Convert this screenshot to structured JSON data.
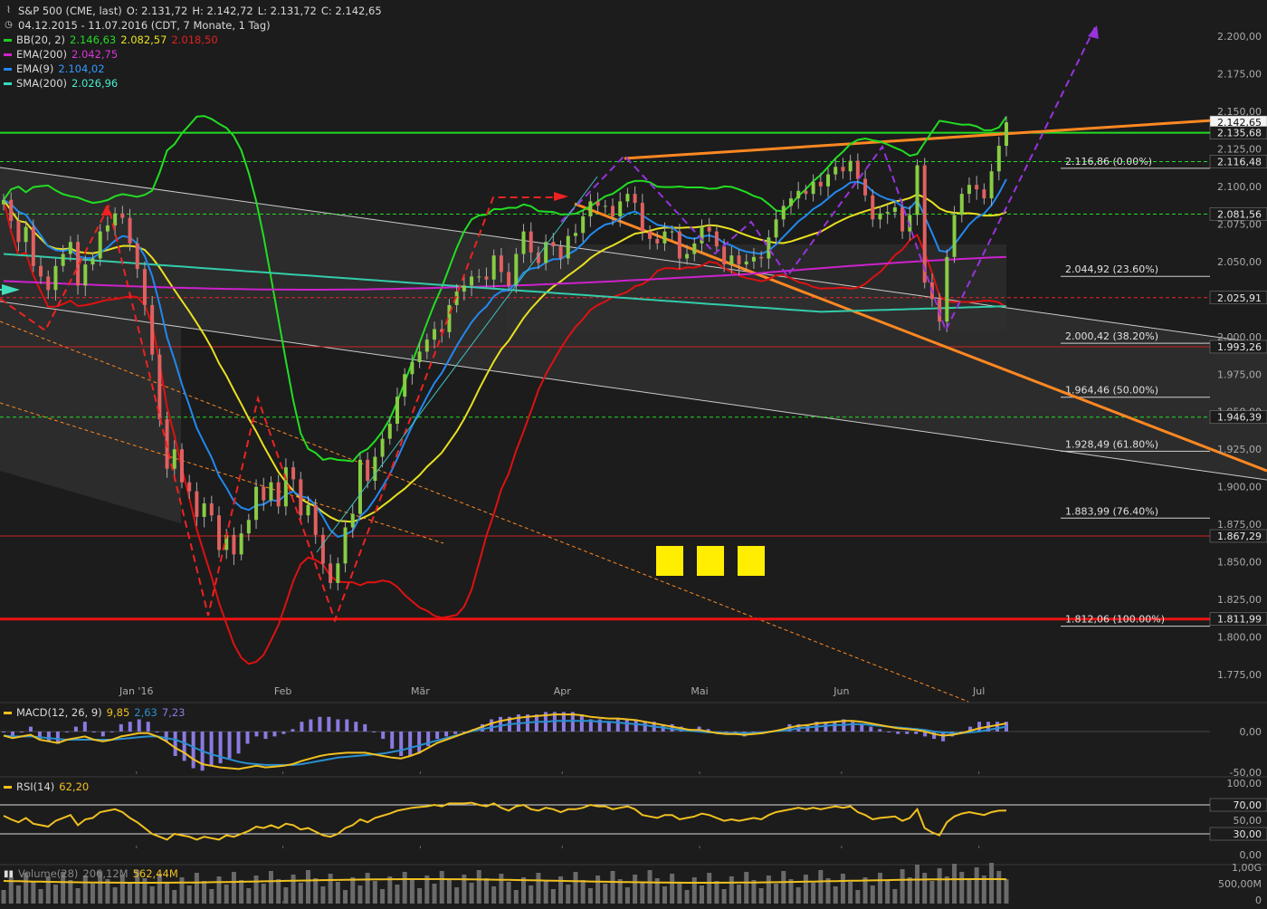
{
  "header": {
    "line1": {
      "title": "S&P 500 (CME, last)",
      "o": "O: 2.131,72",
      "h": "H: 2.142,72",
      "l": "L: 2.131,72",
      "c": "C: 2.142,65"
    },
    "line2": "04.12.2015 - 11.07.2016 (CDT, 7 Monate, 1 Tag)",
    "indicators": [
      {
        "name": "BB(20, 2)",
        "color": "#22cc22",
        "values": [
          {
            "text": "2.146,63",
            "color": "#22dd22"
          },
          {
            "text": "2.082,57",
            "color": "#e8e020"
          },
          {
            "text": "2.018,50",
            "color": "#e02020"
          }
        ]
      },
      {
        "name": "EMA(200)",
        "color": "#cc22cc",
        "values": [
          {
            "text": "2.042,75",
            "color": "#dd33dd"
          }
        ]
      },
      {
        "name": "EMA(9)",
        "color": "#2288ee",
        "values": [
          {
            "text": "2.104,02",
            "color": "#3399ff"
          }
        ]
      },
      {
        "name": "SMA(200)",
        "color": "#33ddbb",
        "values": [
          {
            "text": "2.026,96",
            "color": "#44eecc"
          }
        ]
      }
    ]
  },
  "icons": {
    "chart": "chart-type-icon",
    "clock": "clock-icon",
    "sidebar_arrow": "expand-arrow-icon",
    "volume": "bar-chart-icon"
  },
  "colors": {
    "background": "#1c1c1c",
    "up": "#88cc44",
    "down": "#e06060",
    "bb_upper": "#22dd22",
    "bb_mid": "#e8e020",
    "bb_lower": "#dd1111",
    "ema200": "#cc22cc",
    "ema9": "#2288ee",
    "sma200": "#33ccaa",
    "resistance": "#22dd22",
    "support": "#ee1111",
    "trend_orange": "#ff8822",
    "fib": "#d0d0d0",
    "dashed_purple": "#9933dd",
    "dashed_red": "#ee2222",
    "macd": "#f0c020",
    "macd_signal": "#2a8fd0",
    "macd_hist": "#8a7ae0",
    "rsi": "#f0c020",
    "volume": "#6a6a6a",
    "volume_ma": "#f0c020"
  },
  "chart_data": [
    {
      "type": "candlestick",
      "title": "S&P 500 (CME, last)",
      "period": "04.12.2015 - 11.07.2016",
      "ylim": [
        1760,
        2212
      ],
      "yticks": [
        "2.200,00",
        "2.175,00",
        "2.150,00",
        "2.125,00",
        "2.100,00",
        "2.075,00",
        "2.050,00",
        "2.025,00",
        "2.000,00",
        "1.975,00",
        "1.950,00",
        "1.925,00",
        "1.900,00",
        "1.875,00",
        "1.850,00",
        "1.825,00",
        "1.800,00",
        "1.775,00"
      ],
      "ytick_values": [
        2200,
        2175,
        2150,
        2125,
        2100,
        2075,
        2050,
        2025,
        2000,
        1975,
        1950,
        1925,
        1900,
        1875,
        1850,
        1825,
        1800,
        1775
      ],
      "xticks": [
        {
          "label": "Jan '16",
          "day": 29
        },
        {
          "label": "Feb",
          "day": 61
        },
        {
          "label": "Mär",
          "day": 91
        },
        {
          "label": "Apr",
          "day": 122
        },
        {
          "label": "Mai",
          "day": 152
        },
        {
          "label": "Jun",
          "day": 183
        },
        {
          "label": "Jul",
          "day": 213
        }
      ],
      "last_close": 2142.65,
      "price_tags": [
        {
          "text": "2.142,65",
          "value": 2142.65,
          "style": "white"
        },
        {
          "text": "2.135,68",
          "value": 2135.68,
          "style": "plain"
        },
        {
          "text": "2.116,48",
          "value": 2116.48,
          "style": "plain"
        },
        {
          "text": "2.081,56",
          "value": 2081.56,
          "style": "plain"
        },
        {
          "text": "2.025,91",
          "value": 2025.91,
          "style": "plain"
        },
        {
          "text": "1.993,26",
          "value": 1993.26,
          "style": "plain"
        },
        {
          "text": "1.946,39",
          "value": 1946.39,
          "style": "plain"
        },
        {
          "text": "1.867,29",
          "value": 1867.29,
          "style": "plain"
        },
        {
          "text": "1.811,99",
          "value": 1811.99,
          "style": "plain"
        }
      ],
      "fib_levels": [
        {
          "label": "2.116,86 (0.00%)",
          "value": 2116.86
        },
        {
          "label": "2.044,92 (23.60%)",
          "value": 2044.92
        },
        {
          "label": "2.000,42 (38.20%)",
          "value": 2000.42
        },
        {
          "label": "1.964,46 (50.00%)",
          "value": 1964.46
        },
        {
          "label": "1.928,49 (61.80%)",
          "value": 1928.49
        },
        {
          "label": "1.883,99 (76.40%)",
          "value": 1883.99
        },
        {
          "label": "1.812,06 (100.00%)",
          "value": 1812.06
        }
      ],
      "horizontal_lines": [
        {
          "value": 2135.68,
          "color": "#22dd22",
          "style": "solid"
        },
        {
          "value": 2116.48,
          "color": "#22dd22",
          "style": "dashed"
        },
        {
          "value": 2081.56,
          "color": "#22dd22",
          "style": "dashed"
        },
        {
          "value": 2025.91,
          "color": "#ee2222",
          "style": "dashed"
        },
        {
          "value": 1993.26,
          "color": "#cc2222",
          "style": "solid"
        },
        {
          "value": 1946.39,
          "color": "#22dd22",
          "style": "dashed"
        },
        {
          "value": 1867.29,
          "color": "#cc2222",
          "style": "solid"
        },
        {
          "value": 1811.99,
          "color": "#ee1111",
          "style": "thick"
        }
      ],
      "close": [
        2091,
        2077,
        2063,
        2073,
        2047,
        2040,
        2031,
        2047,
        2055,
        2063,
        2034,
        2048,
        2052,
        2070,
        2074,
        2082,
        2079,
        2062,
        2045,
        2021,
        1988,
        1945,
        1912,
        1925,
        1903,
        1897,
        1880,
        1889,
        1881,
        1858,
        1868,
        1855,
        1869,
        1878,
        1900,
        1891,
        1903,
        1887,
        1913,
        1905,
        1881,
        1888,
        1868,
        1849,
        1836,
        1849,
        1873,
        1882,
        1918,
        1904,
        1920,
        1932,
        1942,
        1960,
        1975,
        1983,
        1990,
        1998,
        2005,
        2003,
        2021,
        2030,
        2034,
        2040,
        2040,
        2038,
        2054,
        2043,
        2034,
        2055,
        2070,
        2056,
        2049,
        2063,
        2060,
        2052,
        2067,
        2069,
        2080,
        2090,
        2087,
        2087,
        2080,
        2090,
        2095,
        2089,
        2070,
        2065,
        2062,
        2070,
        2070,
        2052,
        2055,
        2062,
        2073,
        2070,
        2060,
        2048,
        2054,
        2048,
        2050,
        2053,
        2052,
        2066,
        2078,
        2087,
        2092,
        2097,
        2095,
        2103,
        2100,
        2108,
        2113,
        2110,
        2117,
        2105,
        2094,
        2078,
        2082,
        2083,
        2086,
        2070,
        2081,
        2114,
        2036,
        2025,
        2010,
        2053,
        2081,
        2095,
        2101,
        2098,
        2092,
        2110,
        2127,
        2142.65
      ],
      "ohlc_note": "Daily candles Dec 2015 – Jul 2016; values estimated from chart"
    },
    {
      "type": "line",
      "title": "MACD(12, 26, 9)",
      "values_text": [
        "9,85",
        "2,63",
        "7,23"
      ],
      "yticks": [
        "0,00",
        "-50,00"
      ],
      "series": [
        {
          "name": "MACD",
          "points": [
            -5,
            -8,
            -6,
            -4,
            -10,
            -12,
            -14,
            -10,
            -8,
            -6,
            -10,
            -12,
            -10,
            -6,
            -4,
            -2,
            -2,
            -6,
            -12,
            -20,
            -26,
            -34,
            -40,
            -42,
            -44,
            -45,
            -46,
            -44,
            -42,
            -44,
            -43,
            -42,
            -40,
            -36,
            -33,
            -30,
            -28,
            -27,
            -26,
            -26,
            -26,
            -28,
            -30,
            -32,
            -33,
            -30,
            -26,
            -20,
            -14,
            -10,
            -6,
            -2,
            2,
            6,
            10,
            13,
            15,
            17,
            18,
            19,
            20,
            21,
            21,
            21,
            20,
            18,
            17,
            16,
            16,
            15,
            14,
            12,
            10,
            8,
            6,
            4,
            2,
            2,
            0,
            -2,
            -3,
            -3,
            -4,
            -3,
            -2,
            0,
            2,
            5,
            7,
            8,
            10,
            11,
            12,
            13,
            13,
            12,
            10,
            8,
            6,
            4,
            3,
            2,
            0,
            -3,
            -5,
            -4,
            -2,
            1,
            4,
            6,
            8,
            10
          ],
          "color": "#f0c020"
        },
        {
          "name": "Signal",
          "points": [
            -5,
            -6,
            -6,
            -6,
            -7,
            -8,
            -9,
            -10,
            -10,
            -10,
            -10,
            -10,
            -10,
            -9,
            -8,
            -7,
            -6,
            -6,
            -8,
            -10,
            -14,
            -19,
            -24,
            -28,
            -31,
            -34,
            -37,
            -39,
            -40,
            -41,
            -41,
            -41,
            -41,
            -40,
            -38,
            -36,
            -34,
            -32,
            -31,
            -30,
            -29,
            -28,
            -27,
            -25,
            -23,
            -20,
            -17,
            -14,
            -11,
            -8,
            -5,
            -2,
            1,
            3,
            5,
            7,
            9,
            10,
            11,
            12,
            12,
            13,
            13,
            13,
            13,
            13,
            12,
            12,
            11,
            10,
            9,
            8,
            6,
            5,
            3,
            2,
            1,
            0,
            -1,
            -1,
            -2,
            -2,
            -2,
            -2,
            -1,
            0,
            1,
            2,
            4,
            5,
            6,
            7,
            8,
            8,
            9,
            9,
            8,
            7,
            6,
            5,
            4,
            3,
            2,
            0,
            -1,
            -2,
            -2,
            -1,
            0,
            2,
            4,
            6
          ],
          "color": "#2a8fd0"
        }
      ]
    },
    {
      "type": "line",
      "title": "RSI(14)",
      "value_text": "62,20",
      "yticks": [
        "100,00",
        "50,00",
        "0,00"
      ],
      "bands": [
        {
          "text": "70,00",
          "value": 70
        },
        {
          "text": "30,00",
          "value": 30
        }
      ],
      "points": [
        55,
        50,
        46,
        52,
        44,
        42,
        40,
        48,
        52,
        56,
        42,
        50,
        52,
        60,
        62,
        64,
        60,
        52,
        46,
        38,
        30,
        26,
        22,
        30,
        28,
        26,
        22,
        26,
        24,
        22,
        28,
        26,
        30,
        34,
        40,
        38,
        42,
        38,
        44,
        42,
        36,
        38,
        33,
        28,
        26,
        30,
        38,
        42,
        50,
        46,
        52,
        55,
        58,
        62,
        64,
        66,
        67,
        68,
        70,
        68,
        72,
        72,
        72,
        73,
        70,
        68,
        72,
        66,
        62,
        68,
        70,
        64,
        62,
        66,
        64,
        60,
        64,
        64,
        66,
        70,
        68,
        68,
        64,
        66,
        68,
        64,
        56,
        54,
        52,
        56,
        56,
        50,
        52,
        54,
        58,
        56,
        52,
        48,
        50,
        48,
        50,
        52,
        50,
        56,
        60,
        62,
        64,
        66,
        64,
        66,
        64,
        66,
        68,
        66,
        68,
        60,
        56,
        50,
        52,
        53,
        54,
        48,
        52,
        64,
        38,
        32,
        28,
        46,
        54,
        58,
        60,
        58,
        56,
        60,
        62,
        62.2
      ],
      "color": "#f0c020"
    },
    {
      "type": "bar",
      "title": "Volume(28)",
      "values_text": [
        "206,12M",
        "562,44M"
      ],
      "yticks": [
        "1,00G",
        "500,00M",
        "0"
      ]
    }
  ]
}
